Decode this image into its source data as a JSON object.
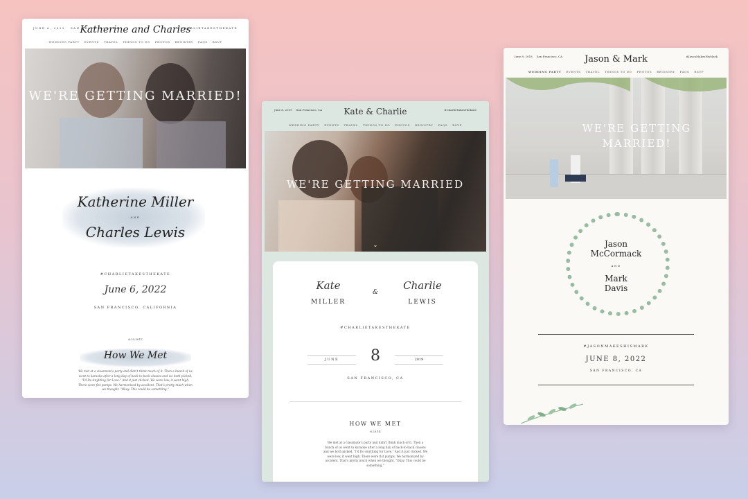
{
  "card1": {
    "top_left_date": "JUNE 6, 2022",
    "top_left_location": "SAN FRANCISCO, CA",
    "top_right_hashtag": "#CHARLIETAKESTHEKATE",
    "logo": "Katherine and Charles",
    "nav": [
      "Wedding Party",
      "Events",
      "Travel",
      "Things to do",
      "Photos",
      "Registry",
      "FAQs",
      "RSVP"
    ],
    "hero_text": "We're getting married!",
    "name1": "Katherine Miller",
    "and": "AND",
    "name2": "Charles Lewis",
    "hashtag": "#CHARLIETAKESTHEKATE",
    "date": "June 6, 2022",
    "location": "SAN FRANCISCO, CALIFORNIA",
    "story_date": "6.23.2017",
    "story_title": "How We Met",
    "story": "We met at a classmate's party and didn't think much of it. Then a bunch of us went to karaoke after a long day of back-to-back classes and we both picked, \"I'd Do Anything for Love.\" And it just clicked. We were low, it went high. There were fist pumps. We harmonized by accident. That's pretty much when we thought, \"Okay. This could be something.\""
  },
  "card2": {
    "top_left_date": "June 8, 2019",
    "top_left_location": "San Francisco, CA",
    "top_right_hashtag": "#CharlieTakesTheKate",
    "logo": "Kate & Charlie",
    "nav": [
      "Wedding Party",
      "Events",
      "Travel",
      "Things to do",
      "Photos",
      "Registry",
      "FAQs",
      "RSVP"
    ],
    "hero_text": "We're getting married",
    "chevron": "⌄",
    "first1": "Kate",
    "last1": "MILLER",
    "amp": "&",
    "first2": "Charlie",
    "last2": "LEWIS",
    "hashtag": "#CHARLIETAKESTHEKATE",
    "month": "JUNE",
    "day": "8",
    "year": "2019",
    "location": "SAN FRANCISCO, CA",
    "story_title": "HOW WE MET",
    "story_date": "6.23.14",
    "story": "We met at a classmate's party and didn't think much of it. Then a bunch of us went to karaoke after a long day of back-to-back classes and we both picked, \"I'd Do Anything for Love.\" And it just clicked. We were low, it went high. There were fist pumps. We harmonized by accident. That's pretty much when we thought, \"Okay. This could be something.\""
  },
  "card3": {
    "top_left_date": "June 8, 2018",
    "top_left_location": "San Francisco, CA",
    "top_right_hashtag": "#JasonMakesHisMark",
    "logo": "Jason & Mark",
    "nav": [
      "Wedding Party",
      "Events",
      "Travel",
      "Things to do",
      "Photos",
      "Registry",
      "FAQs",
      "RSVP"
    ],
    "hero_text": "We're getting married!",
    "name1_first": "Jason",
    "name1_last": "McCormack",
    "and": "AND",
    "name2_first": "Mark",
    "name2_last": "Davis",
    "hashtag": "#JASONMAKESHISMARK",
    "date": "JUNE 8, 2022",
    "location": "SAN FRANCISCO, CA"
  },
  "colors": {
    "bg_top": "#f6c3c0",
    "bg_bottom": "#c9cfe9",
    "card2_tint": "#dde7e2",
    "card3_bg": "#faf9f6",
    "wreath_green": "#7fae8a"
  }
}
